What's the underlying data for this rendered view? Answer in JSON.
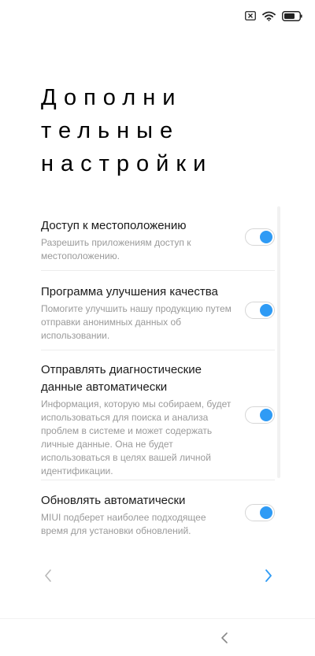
{
  "status_bar": {
    "icons": [
      "no-sim-icon",
      "wifi-icon",
      "battery-icon"
    ]
  },
  "page": {
    "title_lines": [
      "Дополни",
      "тельные",
      "настройки"
    ]
  },
  "settings": [
    {
      "title": "Доступ к местоположению",
      "description": "Разрешить приложениям доступ к местоположению.",
      "enabled": true
    },
    {
      "title": "Программа улучшения качества",
      "description": "Помогите улучшить нашу продукцию путем отправки анонимных данных об использовании.",
      "enabled": true
    },
    {
      "title": "Отправлять диагностические данные автоматически",
      "description": "Информация, которую мы собираем, будет использоваться для поиска и анализа проблем в системе и может содержать личные данные. Она не будет использоваться в целях вашей личной идентификации.",
      "enabled": true
    },
    {
      "title": "Обновлять автоматически",
      "description": "MIUI подберет наиболее подходящее время для установки обновлений.",
      "enabled": true
    }
  ],
  "navigation": {
    "prev_icon": "chevron-left-icon",
    "next_icon": "chevron-right-icon",
    "system_back_icon": "back-icon"
  },
  "colors": {
    "accent": "#2f9bf5",
    "prev_disabled": "#b8b8b8",
    "description_text": "#9a9a9a"
  }
}
